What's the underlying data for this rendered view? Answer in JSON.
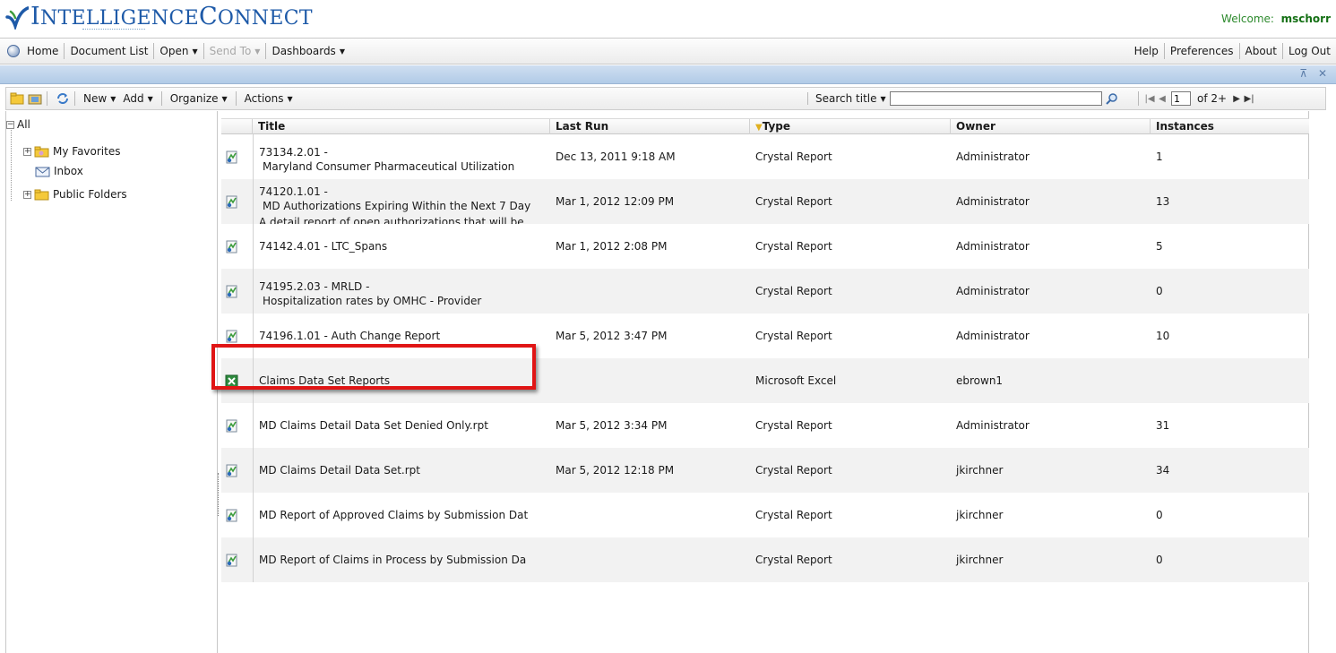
{
  "header": {
    "logo_text_first": "I",
    "logo_text_mid": "NTELLIGENCE",
    "logo_text_c": "C",
    "logo_text_end": "ONNECT",
    "welcome_label": "Welcome:",
    "username": "mschorr"
  },
  "menubar": {
    "home": "Home",
    "document_list": "Document List",
    "open": "Open",
    "send_to": "Send To",
    "dashboards": "Dashboards",
    "help": "Help",
    "preferences": "Preferences",
    "about": "About",
    "logout": "Log Out"
  },
  "titlebar": {
    "controls": "⊼ ✕"
  },
  "toolbar": {
    "new": "New",
    "add": "Add",
    "organize": "Organize",
    "actions": "Actions",
    "search_mode": "Search title",
    "search_value": "",
    "page_current": "1",
    "page_of": "of 2+"
  },
  "tree": {
    "root": "All",
    "items": [
      {
        "label": "My Favorites",
        "icon": "favorites-folder-icon"
      },
      {
        "label": "Inbox",
        "icon": "inbox-icon"
      },
      {
        "label": "Public Folders",
        "icon": "folder-icon"
      }
    ]
  },
  "grid": {
    "columns": {
      "title": "Title",
      "last_run": "Last Run",
      "type": "Type",
      "owner": "Owner",
      "instances": "Instances"
    },
    "rows": [
      {
        "icon": "crystal-report-icon",
        "title": "73134.2.01 -",
        "subtitle": "Maryland Consumer Pharmaceutical Utilization",
        "extra": "",
        "last_run": "Dec 13, 2011 9:18 AM",
        "type": "Crystal Report",
        "owner": "Administrator",
        "instances": "1"
      },
      {
        "icon": "crystal-report-icon",
        "title": "74120.1.01 -",
        "subtitle": "MD Authorizations Expiring Within the Next 7 Day",
        "extra": "A detail report of open authorizations that will be",
        "last_run": "Mar 1, 2012 12:09 PM",
        "type": "Crystal Report",
        "owner": "Administrator",
        "instances": "13"
      },
      {
        "icon": "crystal-report-icon",
        "title": "74142.4.01 - LTC_Spans",
        "subtitle": "",
        "extra": "",
        "last_run": "Mar 1, 2012 2:08 PM",
        "type": "Crystal Report",
        "owner": "Administrator",
        "instances": "5"
      },
      {
        "icon": "crystal-report-icon",
        "title": "74195.2.03 - MRLD -",
        "subtitle": "Hospitalization rates by OMHC - Provider",
        "extra": "",
        "last_run": "",
        "type": "Crystal Report",
        "owner": "Administrator",
        "instances": "0"
      },
      {
        "icon": "crystal-report-icon",
        "title": "74196.1.01 - Auth Change Report",
        "subtitle": "",
        "extra": "",
        "last_run": "Mar 5, 2012 3:47 PM",
        "type": "Crystal Report",
        "owner": "Administrator",
        "instances": "10"
      },
      {
        "icon": "excel-icon",
        "title": "Claims Data Set Reports",
        "subtitle": "",
        "extra": "",
        "last_run": "",
        "type": "Microsoft Excel",
        "owner": "ebrown1",
        "instances": ""
      },
      {
        "icon": "crystal-report-icon",
        "title": "MD Claims Detail Data Set Denied Only.rpt",
        "subtitle": "",
        "extra": "",
        "last_run": "Mar 5, 2012 3:34 PM",
        "type": "Crystal Report",
        "owner": "Administrator",
        "instances": "31"
      },
      {
        "icon": "crystal-report-icon",
        "title": "MD Claims Detail Data Set.rpt",
        "subtitle": "",
        "extra": "",
        "last_run": "Mar 5, 2012 12:18 PM",
        "type": "Crystal Report",
        "owner": "jkirchner",
        "instances": "34"
      },
      {
        "icon": "crystal-report-icon",
        "title": "MD Report of Approved Claims by Submission Dat",
        "subtitle": "",
        "extra": "",
        "last_run": "",
        "type": "Crystal Report",
        "owner": "jkirchner",
        "instances": "0"
      },
      {
        "icon": "crystal-report-icon",
        "title": "MD Report of Claims in Process by Submission Da",
        "subtitle": "",
        "extra": "",
        "last_run": "",
        "type": "Crystal Report",
        "owner": "jkirchner",
        "instances": "0"
      }
    ]
  },
  "colors": {
    "logo_blue": "#1e5aa8",
    "welcome_green": "#2d8a2d",
    "highlight_red": "#e01515",
    "titlebar_blue": "#b1cbe7"
  }
}
